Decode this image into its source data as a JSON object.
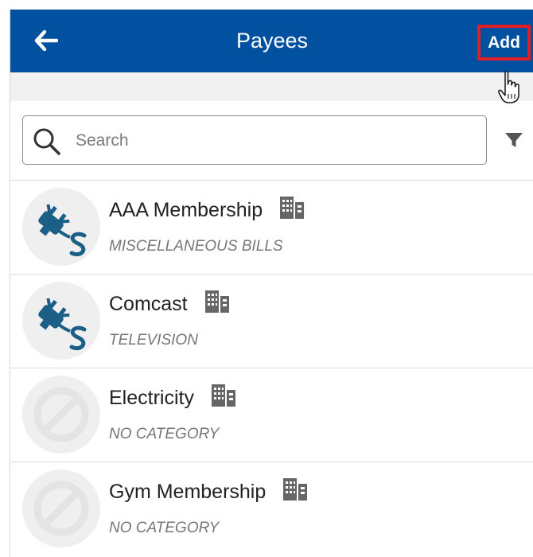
{
  "header": {
    "title": "Payees",
    "add_label": "Add",
    "background": "#0151a0",
    "highlight_color": "#e01e2a"
  },
  "search": {
    "placeholder": "Search"
  },
  "icons": {
    "back": "arrow-left-icon",
    "search": "search-icon",
    "filter": "filter-icon",
    "cursor": "hand-pointer-icon",
    "building": "building-icon",
    "bill": "plug-dollar-icon",
    "none": "ban-icon"
  },
  "payees": [
    {
      "name": "AAA Membership",
      "category": "MISCELLANEOUS BILLS",
      "icon": "plug-dollar-icon"
    },
    {
      "name": "Comcast",
      "category": "TELEVISION",
      "icon": "plug-dollar-icon"
    },
    {
      "name": "Electricity",
      "category": "NO CATEGORY",
      "icon": "ban-icon"
    },
    {
      "name": "Gym Membership",
      "category": "NO CATEGORY",
      "icon": "ban-icon"
    }
  ]
}
